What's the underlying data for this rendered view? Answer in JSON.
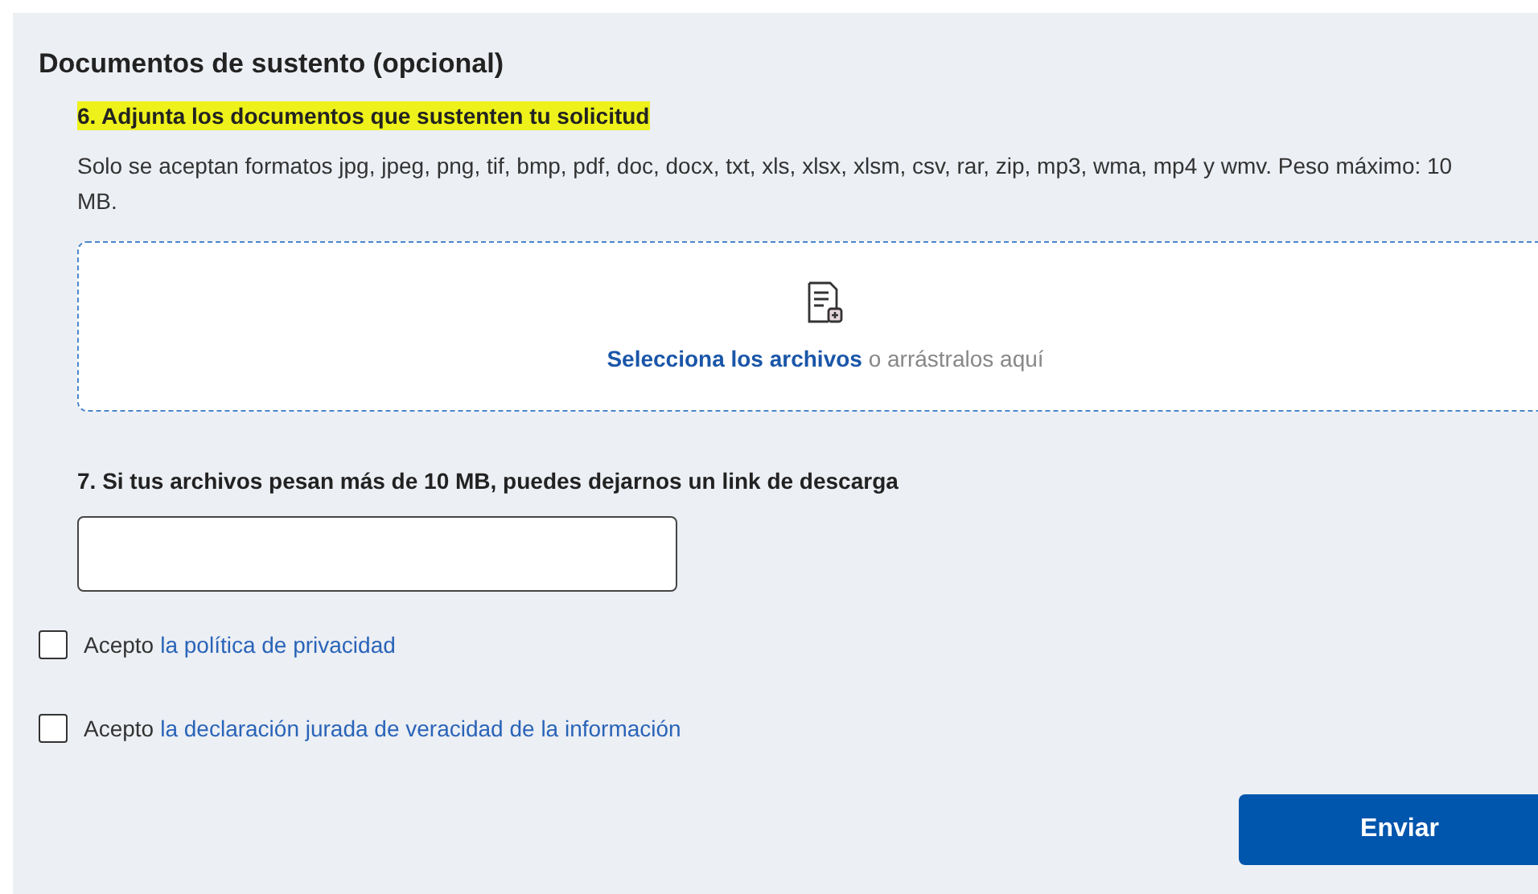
{
  "section": {
    "title": "Documentos de sustento (opcional)"
  },
  "question_6": {
    "label": "6. Adjunta los documentos que sustenten tu solicitud",
    "highlighted": true,
    "help": "Solo se aceptan formatos jpg, jpeg, png, tif, bmp, pdf, doc, docx, txt, xls, xlsx, xlsm, csv, rar, zip, mp3, wma, mp4 y wmv. Peso máximo: 10 MB."
  },
  "dropzone": {
    "link": "Selecciona los archivos",
    "text": "o arrástralos aquí"
  },
  "question_7": {
    "label": "7. Si tus archivos pesan más de 10 MB, puedes dejarnos un link de descarga"
  },
  "consents": [
    {
      "prefix": "Acepto",
      "link": "la política de privacidad",
      "checked": false
    },
    {
      "prefix": "Acepto",
      "link": "la declaración jurada de veracidad de la información",
      "checked": false
    }
  ],
  "submit": {
    "label": "Enviar"
  }
}
